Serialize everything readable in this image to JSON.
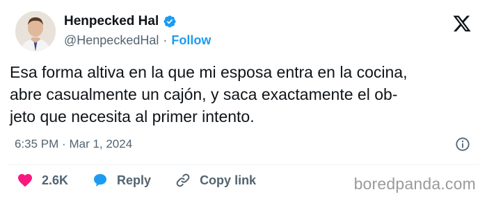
{
  "author": {
    "display_name": "Henpecked Hal",
    "handle": "@HenpeckedHal",
    "separator": "·",
    "follow_label": "Follow",
    "verified_color": "#1d9bf0"
  },
  "tweet": {
    "lines": [
      "Esa forma altiva en la que mi esposa entra en la cocina,",
      "abre casualmente un cajón, y saca exactamente el ob-",
      "jeto que necesita al primer intento."
    ],
    "time": "6:35 PM",
    "date_separator": "·",
    "date": "Mar 1, 2024"
  },
  "actions": {
    "like_count": "2.6K",
    "reply_label": "Reply",
    "copy_link_label": "Copy link",
    "like_color": "#f91880",
    "reply_color": "#1d9bf0"
  },
  "watermark": "boredpanda.com",
  "icons": [
    "avatar",
    "verified-badge-icon",
    "x-logo-icon",
    "info-icon",
    "heart-icon",
    "reply-bubble-icon",
    "link-icon"
  ]
}
